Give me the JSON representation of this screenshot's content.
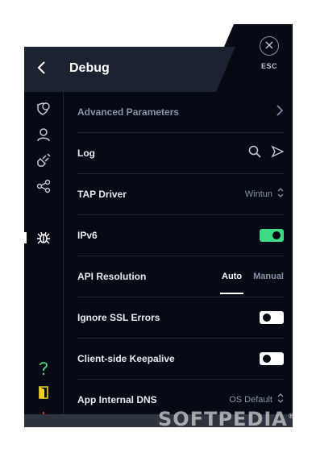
{
  "header": {
    "title": "Debug",
    "esc_label": "ESC",
    "back_icon": "chevron-left-icon",
    "close_icon": "close-icon"
  },
  "sidebar": {
    "items": [
      {
        "icon": "shield-globe-icon"
      },
      {
        "icon": "user-icon"
      },
      {
        "icon": "plug-icon"
      },
      {
        "icon": "share-icon"
      },
      {
        "icon": "bug-icon",
        "active": true
      }
    ],
    "bottom": [
      {
        "icon": "help-icon",
        "color": "#3ddc84"
      },
      {
        "icon": "door-exit-icon",
        "color": "#f2d024"
      },
      {
        "icon": "power-icon",
        "color": "#e53935"
      }
    ]
  },
  "settings": {
    "advanced": {
      "label": "Advanced Parameters"
    },
    "log": {
      "label": "Log"
    },
    "tap_driver": {
      "label": "TAP Driver",
      "value": "Wintun"
    },
    "ipv6": {
      "label": "IPv6",
      "enabled": true
    },
    "api_resolution": {
      "label": "API Resolution",
      "options": [
        "Auto",
        "Manual"
      ],
      "selected": "Auto"
    },
    "ignore_ssl": {
      "label": "Ignore SSL Errors",
      "enabled": false
    },
    "keepalive": {
      "label": "Client-side Keepalive",
      "enabled": false
    },
    "dns": {
      "label": "App Internal DNS",
      "value": "OS Default"
    }
  },
  "colors": {
    "background": "#050a14",
    "panel": "#1b2230",
    "accent_green": "#3ddc84"
  },
  "watermark": {
    "text": "SOFTPEDIA",
    "mark": "®"
  }
}
